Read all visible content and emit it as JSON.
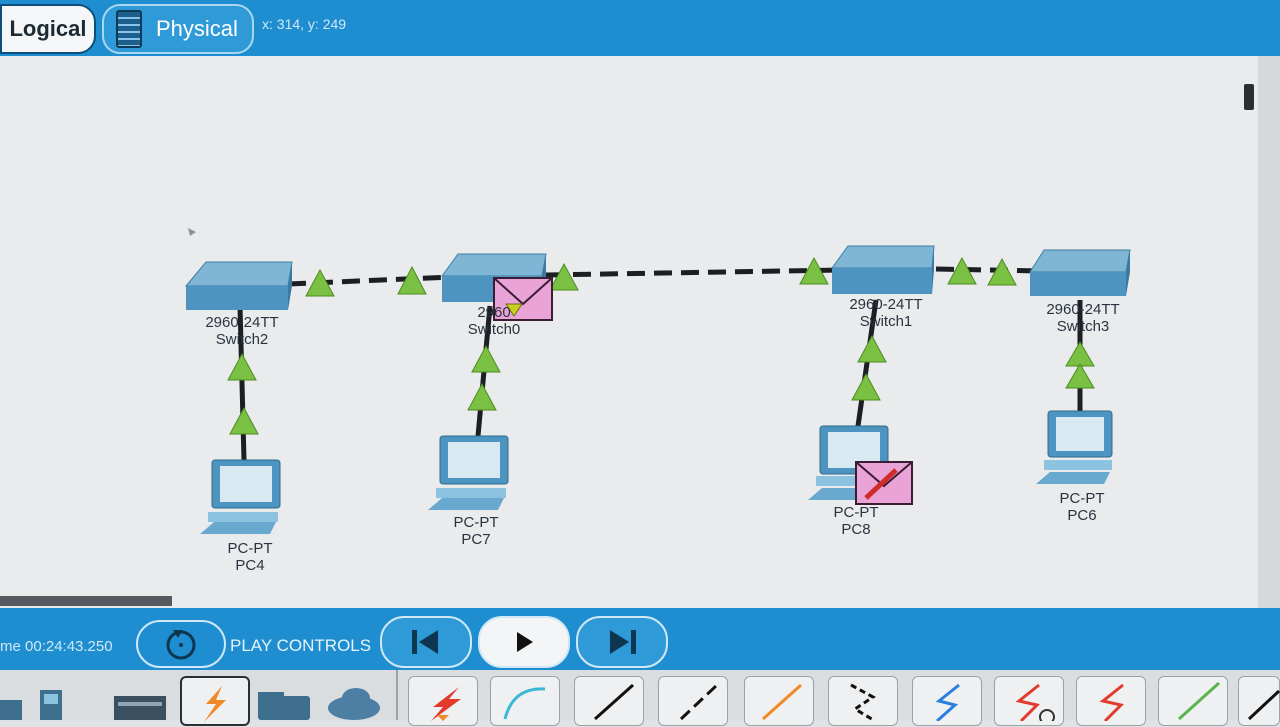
{
  "toolbar": {
    "logical_label": "Logical",
    "physical_label": "Physical",
    "coords": "x: 314, y: 249"
  },
  "topology": {
    "switches": [
      {
        "id": "switch2",
        "model": "2960-24TT",
        "name": "Switch2"
      },
      {
        "id": "switch0",
        "model": "2960",
        "name": "Switch0"
      },
      {
        "id": "switch1",
        "model": "2960-24TT",
        "name": "Switch1"
      },
      {
        "id": "switch3",
        "model": "2960-24TT",
        "name": "Switch3"
      }
    ],
    "pcs": [
      {
        "id": "pc4",
        "model": "PC-PT",
        "name": "PC4"
      },
      {
        "id": "pc7",
        "model": "PC-PT",
        "name": "PC7"
      },
      {
        "id": "pc8",
        "model": "PC-PT",
        "name": "PC8"
      },
      {
        "id": "pc6",
        "model": "PC-PT",
        "name": "PC6"
      }
    ],
    "link_status_color": "#7ac143",
    "pdu_color": "#e9a3d6"
  },
  "playbar": {
    "time": "me 00:24:43.250",
    "label": "PLAY CONTROLS",
    "icons": [
      "reset-simulation-icon",
      "back-icon",
      "play-icon",
      "forward-icon"
    ]
  },
  "palette": {
    "device_icons": [
      "end-devices-icon",
      "network-devices-icon",
      "components-icon",
      "connections-icon",
      "misc-icon",
      "cloud-icon"
    ],
    "cable_icons": [
      "automatic-cable-icon",
      "console-cable-icon",
      "copper-straight-icon",
      "copper-cross-icon",
      "fiber-icon",
      "phone-cable-icon",
      "coaxial-icon",
      "serial-dce-icon",
      "serial-dte-icon",
      "octal-icon",
      "usb-icon"
    ],
    "colors": {
      "accent": "#1f8ed0",
      "cable_red": "#e23b2e",
      "cable_blue": "#2a7fe0",
      "cable_orange": "#f08a24",
      "cable_green": "#59b64a"
    }
  }
}
